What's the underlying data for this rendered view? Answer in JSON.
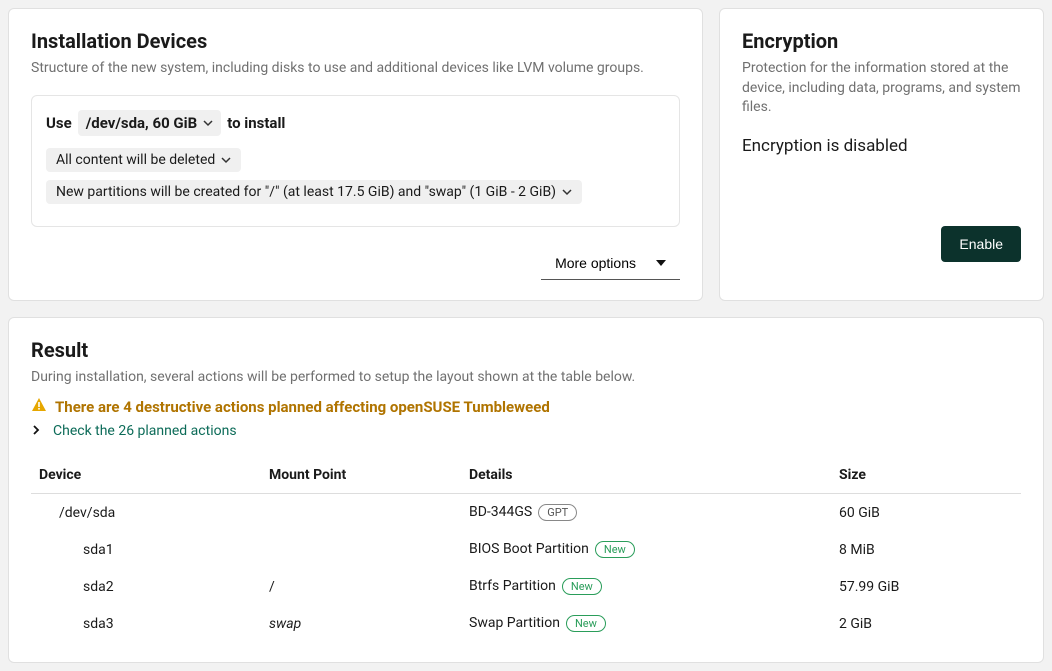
{
  "installDevices": {
    "title": "Installation Devices",
    "subtitle": "Structure of the new system, including disks to use and additional devices like LVM volume groups.",
    "use_prefix": "Use",
    "device_label": "/dev/sda, 60 GiB",
    "use_suffix": "to install",
    "content_pill": "All content will be deleted",
    "partitions_pill": "New partitions will be created for \"/\" (at least 17.5 GiB) and \"swap\" (1 GiB - 2 GiB)",
    "more_options": "More options"
  },
  "encryption": {
    "title": "Encryption",
    "subtitle": "Protection for the information stored at the device, including data, programs, and system files.",
    "status": "Encryption is disabled",
    "enable_label": "Enable"
  },
  "result": {
    "title": "Result",
    "subtitle": "During installation, several actions will be performed to setup the layout shown at the table below.",
    "warning": "There are 4 destructive actions planned affecting openSUSE Tumbleweed",
    "check_actions": "Check the 26 planned actions",
    "columns": {
      "device": "Device",
      "mount": "Mount Point",
      "details": "Details",
      "size": "Size"
    },
    "rows": [
      {
        "device": "/dev/sda",
        "indent": 1,
        "mount": "",
        "details": "BD-344GS",
        "badge": "GPT",
        "badge_style": "gray",
        "size": "60 GiB"
      },
      {
        "device": "sda1",
        "indent": 2,
        "mount": "",
        "details": "BIOS Boot Partition",
        "badge": "New",
        "badge_style": "green",
        "size": "8 MiB"
      },
      {
        "device": "sda2",
        "indent": 2,
        "mount": "/",
        "details": "Btrfs Partition",
        "badge": "New",
        "badge_style": "green",
        "size": "57.99 GiB"
      },
      {
        "device": "sda3",
        "indent": 2,
        "mount": "swap",
        "mount_italic": true,
        "details": "Swap Partition",
        "badge": "New",
        "badge_style": "green",
        "size": "2 GiB"
      }
    ]
  }
}
